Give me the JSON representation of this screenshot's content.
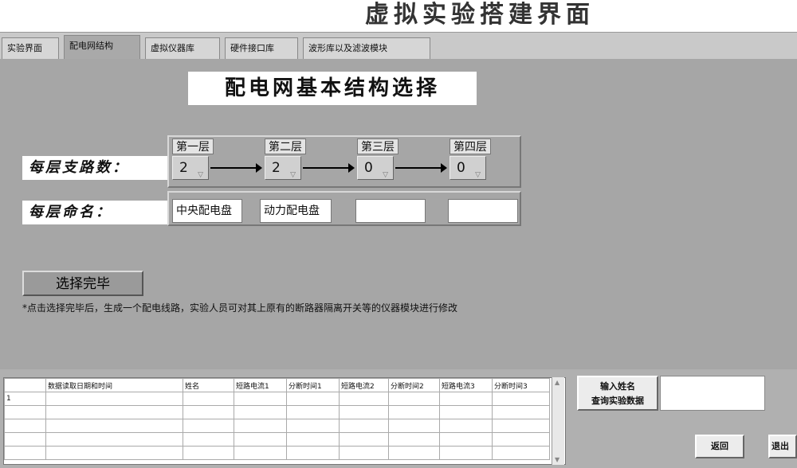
{
  "page_title": "虚拟实验搭建界面",
  "tabs": [
    "实验界面",
    "配电网结构",
    "虚拟仪器库",
    "硬件接口库",
    "波形库以及滤波模块"
  ],
  "active_tab": 1,
  "panel": {
    "heading": "配电网基本结构选择",
    "branch_label": "每层支路数：",
    "name_label": "每层命名：",
    "layers": [
      {
        "caption": "第一层",
        "branches": "2",
        "name": "中央配电盘"
      },
      {
        "caption": "第二层",
        "branches": "2",
        "name": "动力配电盘"
      },
      {
        "caption": "第三层",
        "branches": "0",
        "name": ""
      },
      {
        "caption": "第四层",
        "branches": "0",
        "name": ""
      }
    ],
    "finish_button": "选择完毕",
    "note": "*点击选择完毕后，生成一个配电线路，实验人员可对其上原有的断路器隔离开关等的仪器模块进行修改"
  },
  "table": {
    "headers": [
      "",
      "数据读取日期和时间",
      "姓名",
      "短路电流1",
      "分断时间1",
      "短路电流2",
      "分断时间2",
      "短路电流3",
      "分断时间3"
    ],
    "first_row_index": "1"
  },
  "query_button": {
    "line1": "输入姓名",
    "line2": "查询实验数据"
  },
  "return_button": "返回",
  "exit_button": "退出"
}
